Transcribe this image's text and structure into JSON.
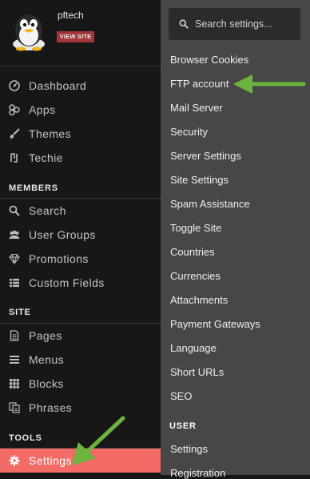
{
  "profile": {
    "username": "pftech",
    "view_site_label": "VIEW SITE"
  },
  "sidebar": {
    "main_items": [
      {
        "label": "Dashboard",
        "icon": "dashboard-icon"
      },
      {
        "label": "Apps",
        "icon": "apps-icon"
      },
      {
        "label": "Themes",
        "icon": "brush-icon"
      },
      {
        "label": "Techie",
        "icon": "techie-icon"
      }
    ],
    "sections": [
      {
        "title": "MEMBERS",
        "items": [
          {
            "label": "Search",
            "icon": "search-icon"
          },
          {
            "label": "User Groups",
            "icon": "user-groups-icon"
          },
          {
            "label": "Promotions",
            "icon": "diamond-icon"
          },
          {
            "label": "Custom Fields",
            "icon": "list-icon"
          }
        ]
      },
      {
        "title": "SITE",
        "items": [
          {
            "label": "Pages",
            "icon": "page-icon"
          },
          {
            "label": "Menus",
            "icon": "menu-icon"
          },
          {
            "label": "Blocks",
            "icon": "blocks-icon"
          },
          {
            "label": "Phrases",
            "icon": "phrases-icon"
          }
        ]
      },
      {
        "title": "TOOLS",
        "items": [
          {
            "label": "Settings",
            "icon": "gear-icon",
            "active": true
          }
        ]
      }
    ]
  },
  "settings_panel": {
    "search_placeholder": "Search settings...",
    "items": [
      "Browser Cookies",
      "FTP account",
      "Mail Server",
      "Security",
      "Server Settings",
      "Site Settings",
      "Spam Assistance",
      "Toggle Site",
      "Countries",
      "Currencies",
      "Attachments",
      "Payment Gateways",
      "Language",
      "Short URLs",
      "SEO"
    ],
    "user_section": {
      "title": "USER",
      "items": [
        "Settings",
        "Registration"
      ]
    }
  },
  "colors": {
    "sidebar_bg": "#171717",
    "panel_bg": "#474747",
    "active_bg": "#f26b66",
    "badge_bg": "#a3363a",
    "arrow_green": "#6db33f"
  }
}
